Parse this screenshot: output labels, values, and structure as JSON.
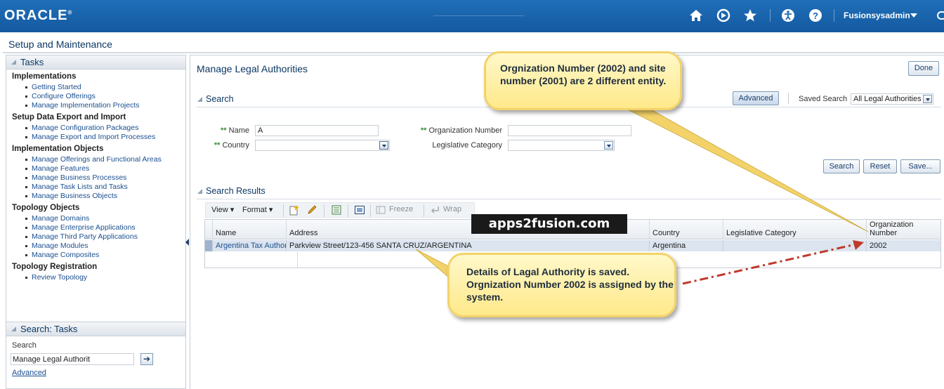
{
  "header": {
    "logo": "ORACLE",
    "user": "Fusionsysadmin",
    "icons": [
      "home-icon",
      "navigator-icon",
      "favorites-icon",
      "accessibility-icon",
      "help-icon"
    ]
  },
  "shell": {
    "title": "Setup and Maintenance"
  },
  "tasks_panel": {
    "title": "Tasks",
    "groups": [
      {
        "title": "Implementations",
        "items": [
          "Getting Started",
          "Configure Offerings",
          "Manage Implementation Projects"
        ]
      },
      {
        "title": "Setup Data Export and Import",
        "items": [
          "Manage Configuration Packages",
          "Manage Export and Import Processes"
        ]
      },
      {
        "title": "Implementation Objects",
        "items": [
          "Manage Offerings and Functional Areas",
          "Manage Features",
          "Manage Business Processes",
          "Manage Task Lists and Tasks",
          "Manage Business Objects"
        ]
      },
      {
        "title": "Topology Objects",
        "items": [
          "Manage Domains",
          "Manage Enterprise Applications",
          "Manage Third Party Applications",
          "Manage Modules",
          "Manage Composites"
        ]
      },
      {
        "title": "Topology Registration",
        "items": [
          "Review Topology"
        ]
      }
    ]
  },
  "search_tasks": {
    "title": "Search: Tasks",
    "label": "Search",
    "value": "Manage Legal Authorit",
    "advanced": "Advanced"
  },
  "main": {
    "title": "Manage Legal Authorities",
    "done": "Done",
    "search": {
      "title": "Search",
      "advanced": "Advanced",
      "saved_search_label": "Saved Search",
      "saved_search_value": "All Legal Authorities",
      "required_marker": "**",
      "name_label": "Name",
      "name_value": "A",
      "country_label": "Country",
      "country_value": "",
      "org_number_label": "Organization Number",
      "org_number_value": "",
      "legislative_label": "Legislative Category",
      "legislative_value": "",
      "search_button": "Search",
      "reset_button": "Reset",
      "save_button": "Save..."
    },
    "results": {
      "title": "Search Results",
      "toolbar": {
        "view": "View",
        "format": "Format",
        "freeze": "Freeze",
        "wrap": "Wrap"
      },
      "columns": [
        "Name",
        "Address",
        "Country",
        "Legislative Category",
        "Organization Number"
      ],
      "rows": [
        {
          "name": "Argentina Tax Authori",
          "address": "Parkview Street/123-456 SANTA CRUZ/ARGENTINA",
          "country": "Argentina",
          "legislative": "",
          "org_number": "2002"
        }
      ]
    }
  },
  "watermark": "apps2fusion.com",
  "callouts": {
    "top": "Orgnization Number (2002) and site number (2001) are 2 different entity.",
    "bottom": "Details of Lagal Authority is saved. Orgnization Number 2002 is assigned by the system."
  },
  "colors": {
    "header": "#1a64ad",
    "callout": "#ffe98a",
    "arrow": "#c0392b"
  }
}
